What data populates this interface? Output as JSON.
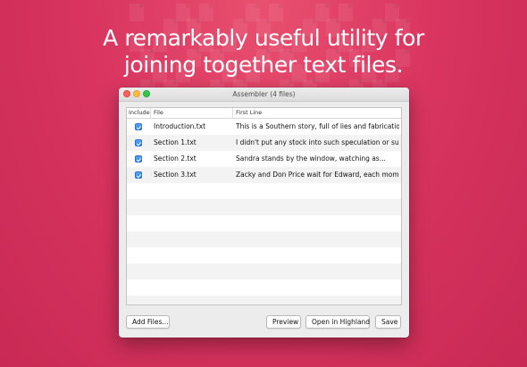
{
  "headline": {
    "line1": "A remarkably useful utility for",
    "line2": "joining together text files."
  },
  "window": {
    "title": "Assembler (4 files)"
  },
  "table": {
    "columns": [
      "Include",
      "File",
      "First Line"
    ],
    "rows": [
      {
        "include": true,
        "file": "Introduction.txt",
        "first_line": "This is a Southern story, full of lies and fabrications, but..."
      },
      {
        "include": true,
        "file": "Section 1.txt",
        "first_line": "I didn't put any stock into such speculation or superstition."
      },
      {
        "include": true,
        "file": "Section 2.txt",
        "first_line": "Sandra stands by the window, watching as..."
      },
      {
        "include": true,
        "file": "Section 3.txt",
        "first_line": "Zacky and Don Price wait for Edward, each moment more"
      }
    ]
  },
  "buttons": {
    "add_files": "Add Files...",
    "preview": "Preview",
    "open_in_highland": "Open in Highland",
    "save": "Save"
  },
  "colors": {
    "background": "#d93560",
    "checkbox_accent": "#2d81ef"
  }
}
